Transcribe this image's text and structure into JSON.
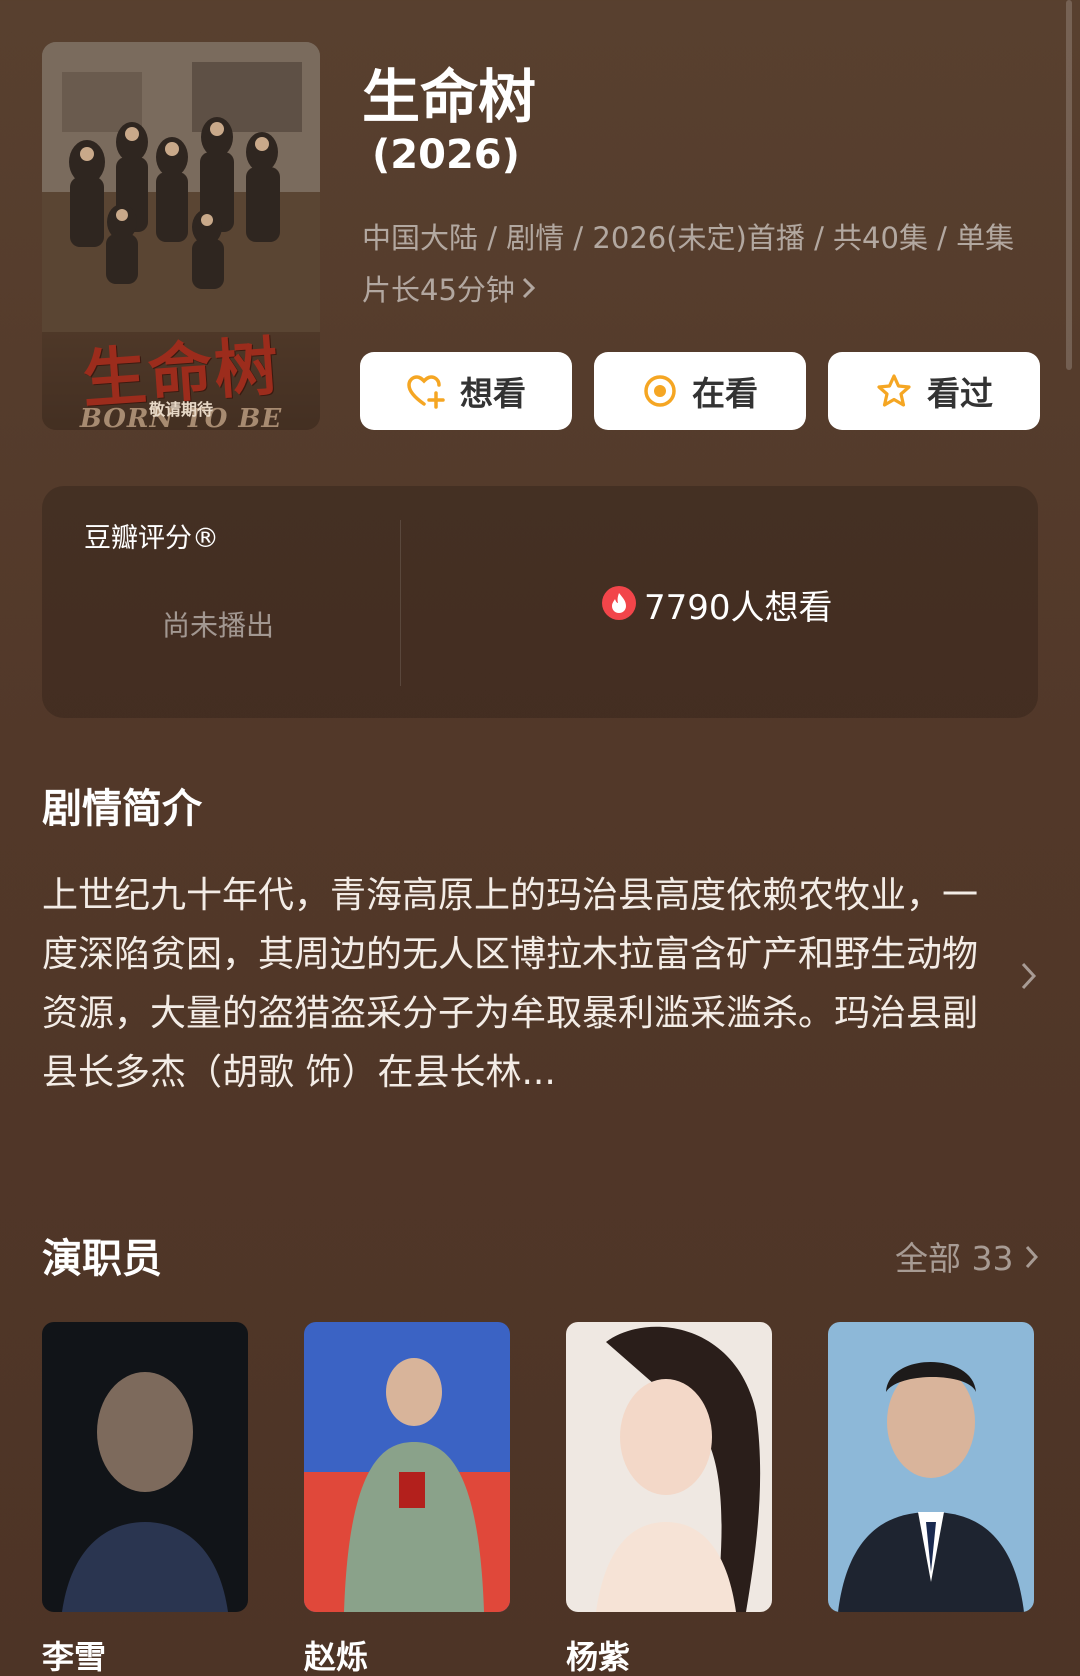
{
  "poster": {
    "title_art": "生命树",
    "subtitle_art": "BORN TO BE ALIVE",
    "tag": "敬请期待"
  },
  "show": {
    "title": "生命树",
    "year": "(2026)",
    "meta": "中国大陆 / 剧情 / 2026(未定)首播 / 共40集 / 单集片长45分钟"
  },
  "actions": {
    "want": "想看",
    "watching": "在看",
    "watched": "看过"
  },
  "rating": {
    "label": "豆瓣评分®",
    "status": "尚未播出",
    "want_count": "7790人想看"
  },
  "synopsis": {
    "heading": "剧情简介",
    "text": "上世纪九十年代，青海高原上的玛治县高度依赖农牧业，一度深陷贫困，其周边的无人区博拉木拉富含矿产和野生动物资源，大量的盗猎盗采分子为牟取暴利滥采滥杀。玛治县副县长多杰（胡歌 饰）在县长林..."
  },
  "cast": {
    "heading": "演职员",
    "all_label": "全部 33",
    "members": [
      {
        "name": "李雪"
      },
      {
        "name": "赵烁"
      },
      {
        "name": "杨紫"
      },
      {
        "name": ""
      }
    ]
  },
  "colors": {
    "background": "#543a2b",
    "card": "#4a3224",
    "accent_orange": "#f5a623",
    "fire_red": "#f2454a"
  }
}
